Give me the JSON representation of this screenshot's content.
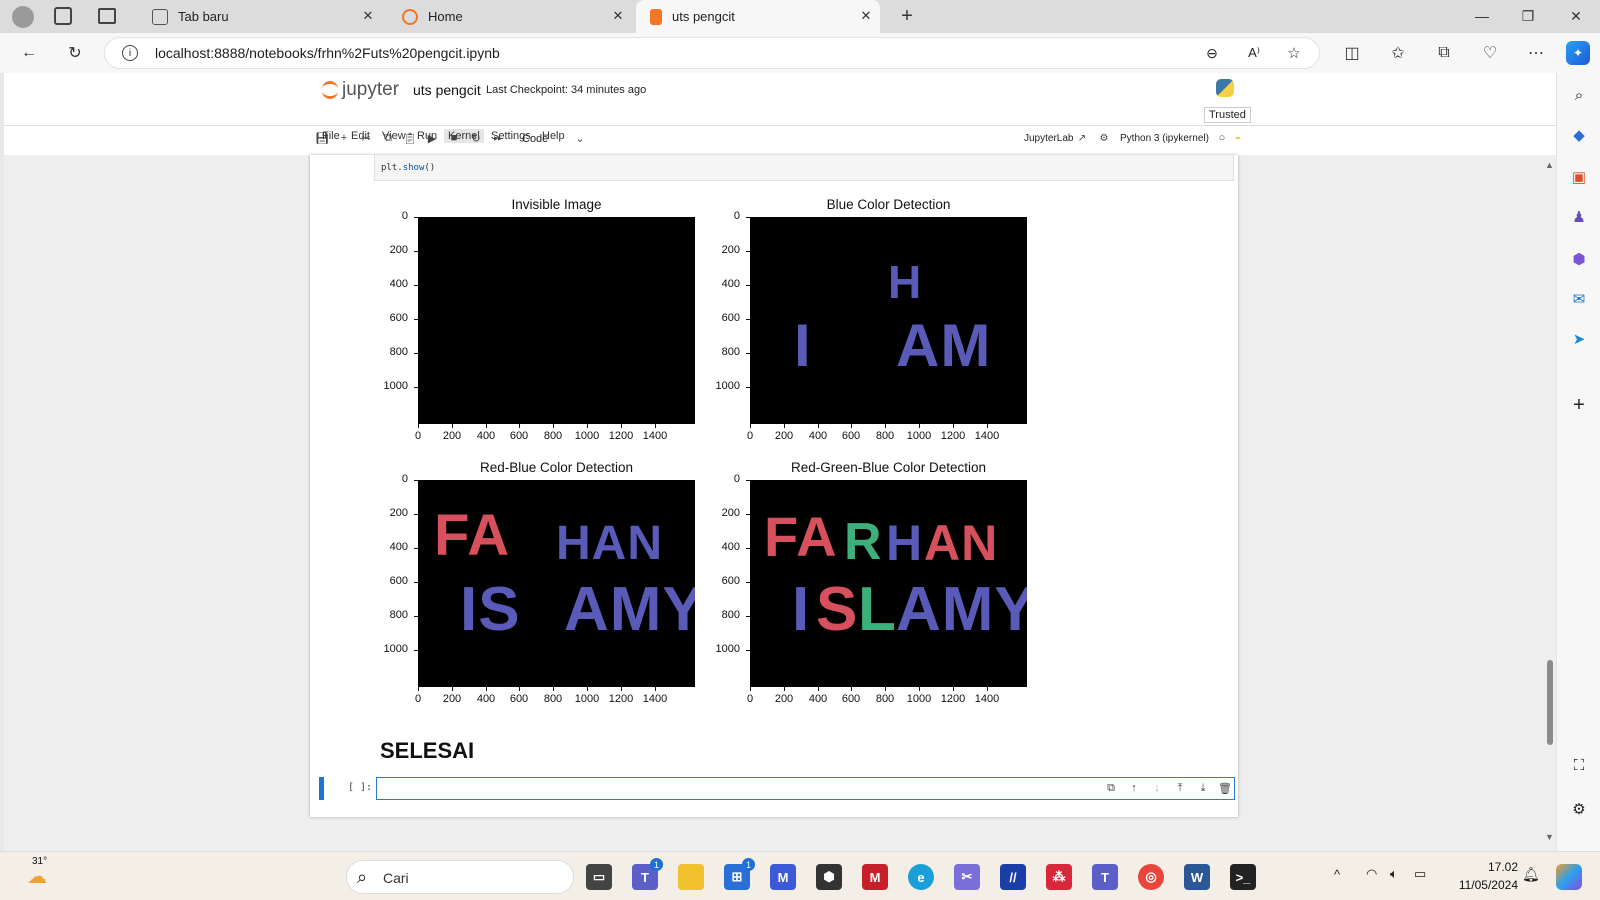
{
  "browser": {
    "tabs": [
      {
        "title": "Tab baru"
      },
      {
        "title": "Home"
      },
      {
        "title": "uts pengcit"
      }
    ],
    "url": "localhost:8888/notebooks/frhn%2Futs%20pengcit.ipynb"
  },
  "jupyter": {
    "logo_text": "jupyter",
    "notebook_title": "uts pengcit",
    "checkpoint": "Last Checkpoint: 34 minutes ago",
    "trusted": "Trusted",
    "menu": [
      "File",
      "Edit",
      "View",
      "Run",
      "Kernel",
      "Settings",
      "Help"
    ],
    "active_menu": "Kernel",
    "cell_type": "Code",
    "jupyterlab_link": "JupyterLab",
    "kernel": "Python 3 (ipykernel)"
  },
  "cell": {
    "code_obj": "plt.",
    "code_fn": "show",
    "code_end": "()",
    "markdown_heading": "SELESAI",
    "empty_prompt": "[ ]:"
  },
  "plots": [
    {
      "title": "Invisible Image"
    },
    {
      "title": "Blue Color Detection"
    },
    {
      "title": "Red-Blue Color Detection"
    },
    {
      "title": "Red-Green-Blue Color Detection"
    }
  ],
  "axes": {
    "y_ticks": [
      "0",
      "200",
      "400",
      "600",
      "800",
      "1000"
    ],
    "x_ticks": [
      "0",
      "200",
      "400",
      "600",
      "800",
      "1000",
      "1200",
      "1400"
    ]
  },
  "image_text": {
    "blue_row1": "H",
    "blue_row2a": "I",
    "blue_row2b": "AM",
    "rb_row1a": "FA",
    "rb_row1b": "HAN",
    "rb_row2a": "IS",
    "rb_row2b": "AMY",
    "rgb_l1": "FA",
    "rgb_l2": "R",
    "rgb_l3": "H",
    "rgb_l4": "AN",
    "rgb_l5": "I",
    "rgb_l6": "S",
    "rgb_l7": "L",
    "rgb_l8": "AMY"
  },
  "taskbar": {
    "temp": "31°",
    "search_placeholder": "Cari",
    "time": "17.02",
    "date": "11/05/2024"
  },
  "colors": {
    "red_text": "#d6505e",
    "blue_text": "#5a5ab8",
    "green_text": "#3daf7a",
    "accent": "#1976d2"
  }
}
